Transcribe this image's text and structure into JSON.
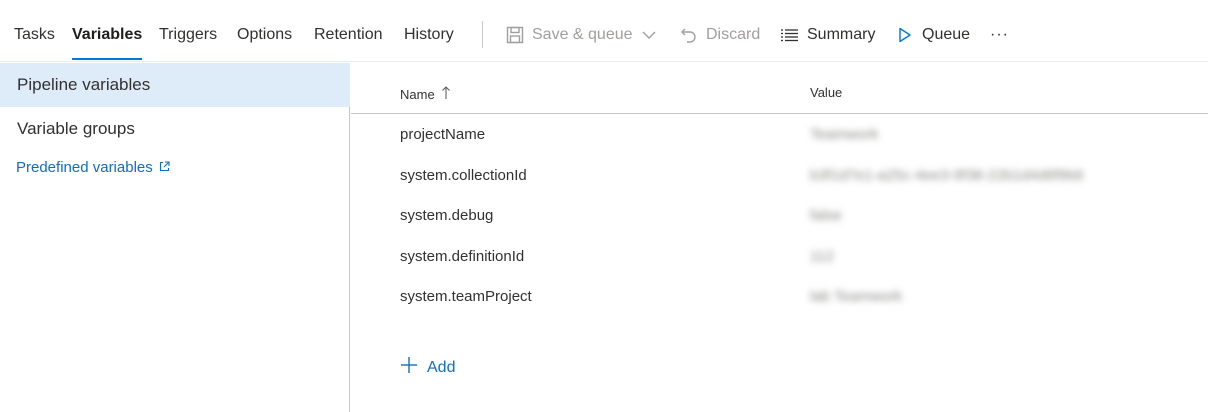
{
  "tabs": [
    {
      "label": "Tasks",
      "active": false
    },
    {
      "label": "Variables",
      "active": true
    },
    {
      "label": "Triggers",
      "active": false
    },
    {
      "label": "Options",
      "active": false
    },
    {
      "label": "Retention",
      "active": false
    },
    {
      "label": "History",
      "active": false
    }
  ],
  "toolbar": {
    "save_queue_label": "Save & queue",
    "discard_label": "Discard",
    "summary_label": "Summary",
    "queue_label": "Queue",
    "more_label": "···"
  },
  "sidebar": {
    "items": [
      {
        "label": "Pipeline variables",
        "selected": true
      },
      {
        "label": "Variable groups",
        "selected": false
      }
    ],
    "link_label": "Predefined variables"
  },
  "table": {
    "headers": {
      "name": "Name",
      "value": "Value"
    },
    "rows": [
      {
        "name": "projectName",
        "value": "Teamwork"
      },
      {
        "name": "system.collectionId",
        "value": "b3f1d7e1-a25c-4ee3-9f38-22b1d4d6f9b6"
      },
      {
        "name": "system.debug",
        "value": "false"
      },
      {
        "name": "system.definitionId",
        "value": "112"
      },
      {
        "name": "system.teamProject",
        "value": "lab Teamwork"
      }
    ],
    "add_label": "Add"
  },
  "colors": {
    "accent": "#0078d4",
    "link": "#106ebe",
    "selected_bg": "#deecf9",
    "disabled_text": "#a19f9d"
  },
  "icons": {
    "save": "save-icon",
    "chevron": "chevron-down-icon",
    "discard": "undo-icon",
    "summary": "list-icon",
    "queue": "play-icon",
    "sort": "arrow-up-icon",
    "external": "external-link-icon",
    "add": "plus-icon"
  }
}
